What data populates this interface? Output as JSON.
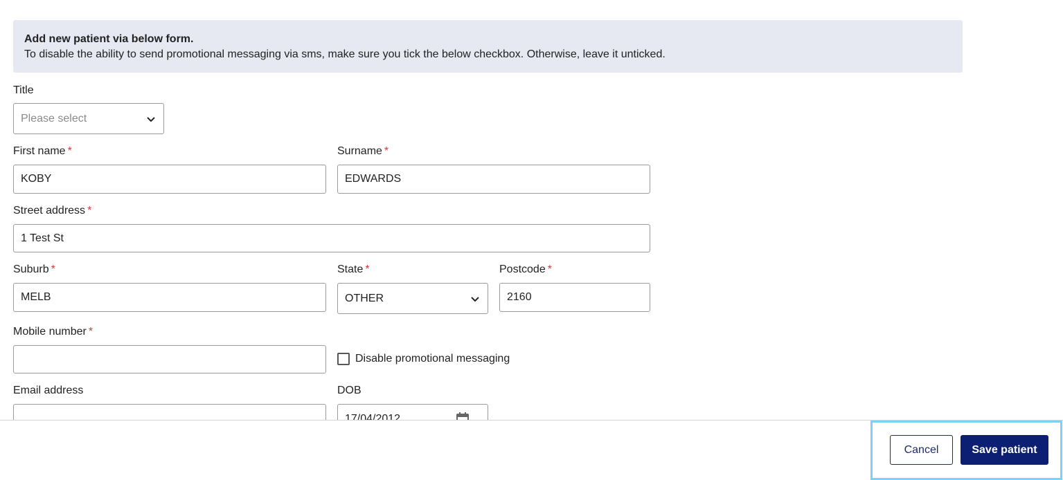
{
  "banner": {
    "title": "Add new patient via below form.",
    "text": "To disable the ability to send promotional messaging via sms, make sure you tick the below checkbox. Otherwise, leave it unticked."
  },
  "form": {
    "title": {
      "label": "Title",
      "placeholder": "Please select"
    },
    "first_name": {
      "label": "First name",
      "value": "KOBY"
    },
    "surname": {
      "label": "Surname",
      "value": "EDWARDS"
    },
    "street_address": {
      "label": "Street address",
      "value": "1 Test St"
    },
    "suburb": {
      "label": "Suburb",
      "value": "MELB"
    },
    "state": {
      "label": "State",
      "value": "OTHER"
    },
    "postcode": {
      "label": "Postcode",
      "value": "2160"
    },
    "mobile": {
      "label": "Mobile number",
      "value": ""
    },
    "disable_promo": {
      "label": "Disable promotional messaging",
      "checked": false
    },
    "email": {
      "label": "Email address",
      "value": ""
    },
    "dob": {
      "label": "DOB",
      "value": "17/04/2012"
    },
    "required_marker": "*"
  },
  "footer": {
    "cancel_label": "Cancel",
    "save_label": "Save patient"
  },
  "colors": {
    "banner_bg": "#e6e8f2",
    "primary": "#0d1f73",
    "required": "#d9363e",
    "highlight": "#7fd0f4"
  },
  "icons": {
    "title_select": "chevron-down-icon",
    "state_select": "chevron-down-icon",
    "dob": "calendar-icon"
  }
}
